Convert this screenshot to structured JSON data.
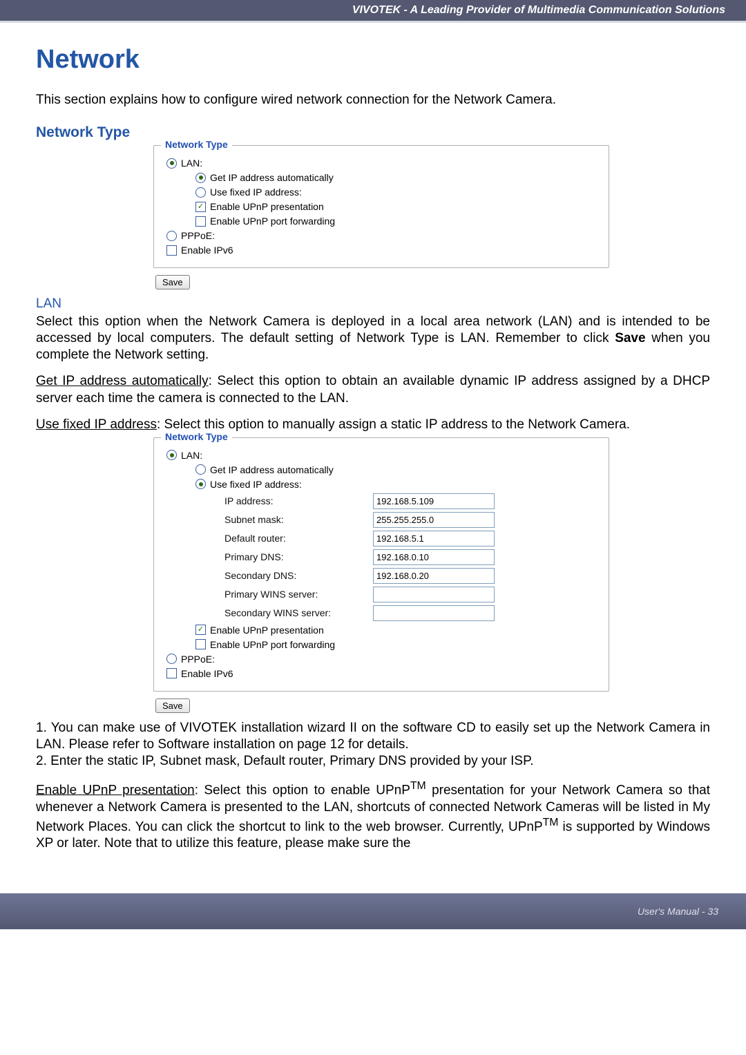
{
  "header_banner": "VIVOTEK - A Leading Provider of Multimedia Communication Solutions",
  "section_title": "Network",
  "intro": "This section explains how to configure wired network connection for the Network Camera.",
  "subheads": {
    "net_type": "Network Type",
    "lan": "LAN"
  },
  "panel1": {
    "legend": "Network Type",
    "lan_label": "LAN:",
    "get_ip_auto": "Get IP address automatically",
    "use_fixed": "Use fixed IP address:",
    "enable_pres": "Enable UPnP presentation",
    "enable_fwd": "Enable UPnP port forwarding",
    "pppoe_label": "PPPoE:",
    "enable_ipv6": "Enable IPv6",
    "save": "Save"
  },
  "lan_para1": "Select this option when the Network Camera is deployed in a local area network (LAN) and is intended to be accessed by local computers. The default setting of Network Type is LAN. Remember to click ",
  "lan_para1_bold": "Save",
  "lan_para1_tail": " when you complete the Network setting.",
  "lan_para2_u": "Get IP address automatically",
  "lan_para2_rest": ": Select this option to obtain an available dynamic IP address assigned by a DHCP server each time the camera is connected to the LAN.",
  "lan_para3_u": "Use fixed IP address",
  "lan_para3_rest": ": Select this option to manually assign a static IP address to the Network Camera.",
  "panel2": {
    "legend": "Network Type",
    "lan_label": "LAN:",
    "get_ip_auto": "Get IP address automatically",
    "use_fixed": "Use fixed IP address:",
    "fields": {
      "ip_label": "IP address:",
      "ip_value": "192.168.5.109",
      "subnet_label": "Subnet mask:",
      "subnet_value": "255.255.255.0",
      "router_label": "Default router:",
      "router_value": "192.168.5.1",
      "pdns_label": "Primary DNS:",
      "pdns_value": "192.168.0.10",
      "sdns_label": "Secondary DNS:",
      "sdns_value": "192.168.0.20",
      "pwins_label": "Primary WINS server:",
      "pwins_value": "",
      "swins_label": "Secondary WINS server:",
      "swins_value": ""
    },
    "enable_pres": "Enable UPnP presentation",
    "enable_fwd": "Enable UPnP port forwarding",
    "pppoe_label": "PPPoE:",
    "enable_ipv6": "Enable IPv6",
    "save": "Save"
  },
  "notes": {
    "n1": "1. You can make use of VIVOTEK installation wizard II on the software CD to easily set up the Network Camera in LAN. Please refer to Software installation on page 12 for details.",
    "n2": "2. Enter the static IP, Subnet mask, Default router, Primary DNS provided by your ISP."
  },
  "upnp_para_u": "Enable UPnP presentation",
  "upnp_para_rest_a": ": Select this option to enable UPnP",
  "upnp_para_rest_b": " presentation for your Network Camera so that whenever a Network Camera is presented to the LAN, shortcuts of connected Network Cameras will be listed in My Network Places. You can click the shortcut to link to the web browser. Currently, UPnP",
  "upnp_para_rest_c": " is supported by Windows XP or later. Note that to utilize this feature, please make sure the",
  "footer": "User's Manual - 33"
}
